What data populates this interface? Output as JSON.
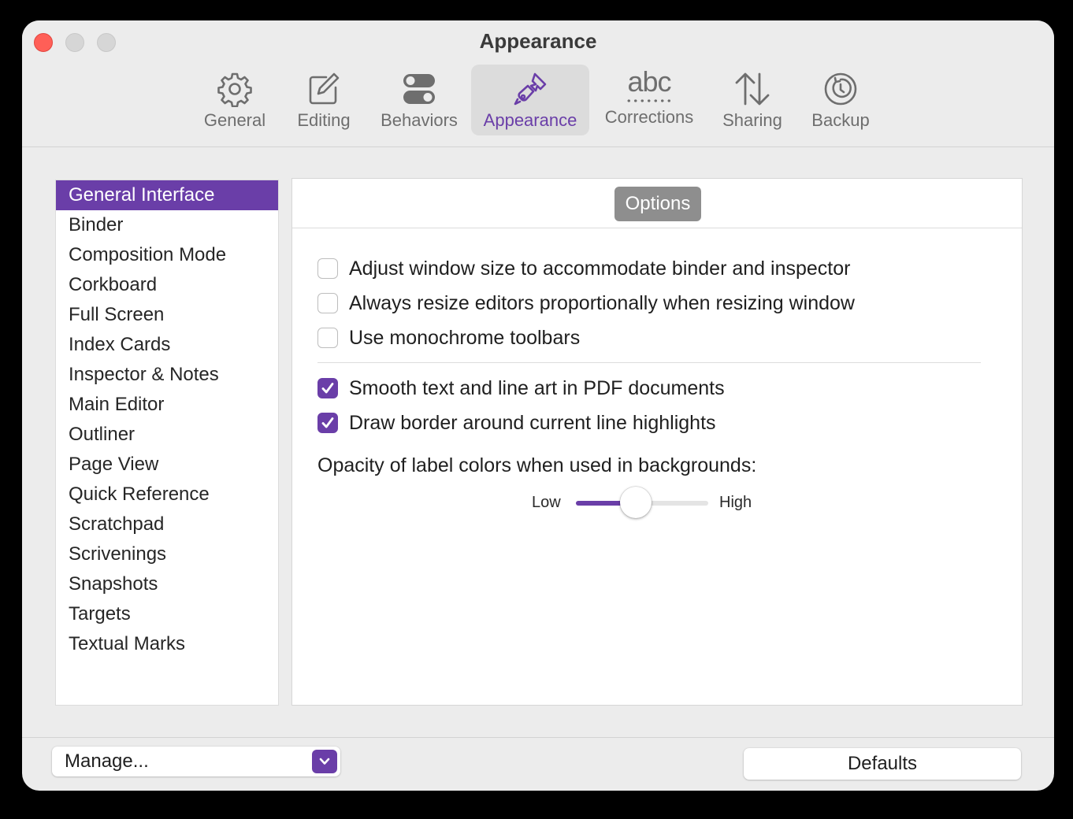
{
  "window": {
    "title": "Appearance"
  },
  "toolbar": {
    "items": [
      {
        "label": "General",
        "icon": "gear-icon"
      },
      {
        "label": "Editing",
        "icon": "edit-icon"
      },
      {
        "label": "Behaviors",
        "icon": "toggles-icon"
      },
      {
        "label": "Appearance",
        "icon": "paintbrush-icon",
        "active": true
      },
      {
        "label": "Corrections",
        "icon": "abc-spellcheck-icon",
        "glyph": "abc"
      },
      {
        "label": "Sharing",
        "icon": "up-down-arrows-icon"
      },
      {
        "label": "Backup",
        "icon": "backup-clock-icon"
      }
    ]
  },
  "sidebar": {
    "selected": "General Interface",
    "items": [
      "General Interface",
      "Binder",
      "Composition Mode",
      "Corkboard",
      "Full Screen",
      "Index Cards",
      "Inspector & Notes",
      "Main Editor",
      "Outliner",
      "Page View",
      "Quick Reference",
      "Scratchpad",
      "Scrivenings",
      "Snapshots",
      "Targets",
      "Textual Marks"
    ]
  },
  "panel": {
    "tab_label": "Options",
    "options": [
      {
        "label": "Adjust window size to accommodate binder and inspector",
        "checked": false
      },
      {
        "label": "Always resize editors proportionally when resizing window",
        "checked": false
      },
      {
        "label": "Use monochrome toolbars",
        "checked": false
      },
      {
        "label": "Smooth text and line art in PDF documents",
        "checked": true
      },
      {
        "label": "Draw border around current line highlights",
        "checked": true
      }
    ],
    "opacity": {
      "label": "Opacity of label colors when used in backgrounds:",
      "low_label": "Low",
      "high_label": "High",
      "value": 0.45
    }
  },
  "bottom": {
    "manage_label": "Manage...",
    "defaults_label": "Defaults"
  },
  "colors": {
    "accent": "#6a3ea8",
    "close": "#ff5f57",
    "window_bg": "#ececec"
  }
}
